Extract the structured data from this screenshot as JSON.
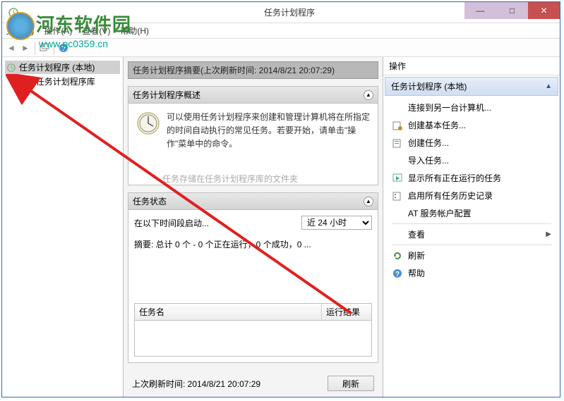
{
  "watermark": {
    "title": "河东软件园",
    "url": "www.pc0359.cn"
  },
  "window": {
    "title": "任务计划程序"
  },
  "menus": {
    "file": "文件(F)",
    "action": "操作(A)",
    "view": "查看(V)",
    "help": "帮助(H)"
  },
  "tree": {
    "root": "任务计划程序 (本地)",
    "child": "任务计划程序库"
  },
  "center": {
    "summary": "任务计划程序摘要(上次刷新时间: 2014/8/21 20:07:29)",
    "overview_header": "任务计划程序概述",
    "overview_text": "可以使用任务计划程序来创建和管理计算机将在所指定的时间自动执行的常见任务。若要开始，请单击\"操作\"菜单中的命令。",
    "overview_hidden": "任务存储在任务计划程序库的文件夹",
    "status_header": "任务状态",
    "status_label": "在以下时间段启动...",
    "status_option": "近 24 小时",
    "status_summary": "摘要: 总计 0 个 - 0 个正在运行，0 个成功，0 ...",
    "col_name": "任务名",
    "col_result": "运行结果",
    "last_refresh": "上次刷新时间: 2014/8/21 20:07:29",
    "refresh_btn": "刷新"
  },
  "actions": {
    "title": "操作",
    "header": "任务计划程序 (本地)",
    "items": {
      "connect": "连接到另一台计算机...",
      "create_basic": "创建基本任务...",
      "create_task": "创建任务...",
      "import": "导入任务...",
      "show_running": "显示所有正在运行的任务",
      "enable_history": "启用所有任务历史记录",
      "at_config": "AT 服务帐户配置",
      "view": "查看",
      "refresh": "刷新",
      "help": "帮助"
    }
  }
}
